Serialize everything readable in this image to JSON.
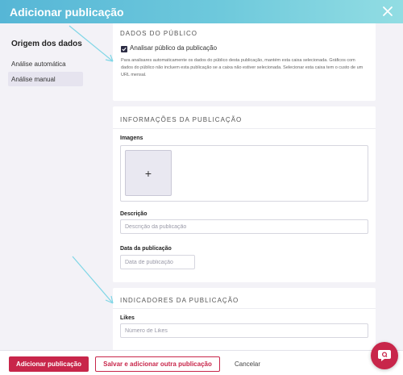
{
  "header": {
    "title": "Adicionar publicação",
    "close_icon": "close-icon"
  },
  "sidebar": {
    "title": "Origem dos dados",
    "items": [
      {
        "label": "Análise automática",
        "active": false
      },
      {
        "label": "Análise manual",
        "active": true
      }
    ]
  },
  "audience": {
    "section_title": "DADOS DO PÚBLICO",
    "checkbox_label": "Analisar público da publicação",
    "checked": true,
    "help_text": "Para analisares automaticamente os dados do público desta publicação, mantém esta caixa selecionada. Gráficos com dados do público não incluem esta publicação se a caixa não estiver selecionada. Selecionar esta caixa tem o custo de um URL mensal."
  },
  "info": {
    "section_title": "INFORMAÇÕES DA PUBLICAÇÃO",
    "images_label": "Imagens",
    "add_image_glyph": "+",
    "description_label": "Descrição",
    "description_placeholder": "Descrição da publicação",
    "date_label": "Data da publicação",
    "date_placeholder": "Data de publicação"
  },
  "indicators": {
    "section_title": "INDICADORES DA PUBLICAÇÃO",
    "likes_label": "Likes",
    "likes_placeholder": "Número de Likes"
  },
  "footer": {
    "primary_label": "Adicionar publicação",
    "secondary_label": "Salvar e adicionar outra publicação",
    "cancel_label": "Cancelar"
  },
  "colors": {
    "accent": "#c8264a",
    "header_start": "#56b6d6",
    "header_end": "#92dde3",
    "annotation_arrow": "#7fd6e6"
  },
  "icons": {
    "chat": "chat-icon",
    "check": "check-icon",
    "plus": "plus-icon"
  }
}
